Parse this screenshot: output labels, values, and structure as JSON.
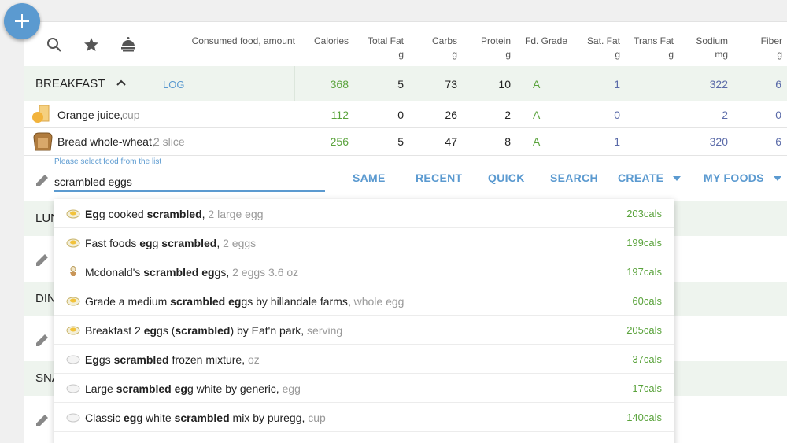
{
  "columns": [
    {
      "label": "Consumed food, amount",
      "unit": ""
    },
    {
      "label": "Calories",
      "unit": ""
    },
    {
      "label": "Total Fat",
      "unit": "g"
    },
    {
      "label": "Carbs",
      "unit": "g"
    },
    {
      "label": "Protein",
      "unit": "g"
    },
    {
      "label": "Fd. Grade",
      "unit": ""
    },
    {
      "label": "Sat. Fat",
      "unit": "g"
    },
    {
      "label": "Trans Fat",
      "unit": "g"
    },
    {
      "label": "Sodium",
      "unit": "mg"
    },
    {
      "label": "Fiber",
      "unit": "g"
    }
  ],
  "breakfast": {
    "title": "BREAKFAST",
    "log_label": "LOG",
    "totals": {
      "calories": "368",
      "fat": "5",
      "carbs": "73",
      "protein": "10",
      "grade": "A",
      "sat_fat": "1",
      "sodium": "322",
      "fiber": "6"
    },
    "items": [
      {
        "name": "Orange juice,",
        "amount": "cup",
        "calories": "112",
        "fat": "0",
        "carbs": "26",
        "protein": "2",
        "grade": "A",
        "sat_fat": "0",
        "sodium": "2",
        "fiber": "0"
      },
      {
        "name": "Bread whole-wheat,",
        "amount": "2 slice",
        "calories": "256",
        "fat": "5",
        "carbs": "47",
        "protein": "8",
        "grade": "A",
        "sat_fat": "1",
        "sodium": "320",
        "fiber": "6"
      }
    ]
  },
  "search": {
    "hint": "Please select food from the list",
    "value": "scrambled eggs"
  },
  "tabs": [
    "SAME",
    "RECENT",
    "QUICK",
    "SEARCH",
    "CREATE",
    "MY FOODS"
  ],
  "sections": [
    "LUN",
    "DIN",
    "SNA"
  ],
  "suggestions": [
    {
      "icon": "egg-icon",
      "parts": [
        [
          "Eg",
          true
        ],
        [
          "g cooked ",
          false
        ],
        [
          "scrambled",
          true
        ],
        [
          ",",
          false
        ]
      ],
      "amount": "2 large egg",
      "cals": "203cals"
    },
    {
      "icon": "egg-icon",
      "parts": [
        [
          "Fast foods ",
          false
        ],
        [
          "eg",
          true
        ],
        [
          "g ",
          false
        ],
        [
          "scrambled",
          true
        ],
        [
          ",",
          false
        ]
      ],
      "amount": "2 eggs",
      "cals": "199cals"
    },
    {
      "icon": "egg-cup-icon",
      "parts": [
        [
          "Mcdonald's ",
          false
        ],
        [
          "scrambled eg",
          true
        ],
        [
          "gs,",
          false
        ]
      ],
      "amount": "2 eggs 3.6 oz",
      "cals": "197cals"
    },
    {
      "icon": "egg-icon",
      "parts": [
        [
          "Grade a medium ",
          false
        ],
        [
          "scrambled eg",
          true
        ],
        [
          "gs by hillandale farms,",
          false
        ]
      ],
      "amount": "whole egg",
      "cals": "60cals"
    },
    {
      "icon": "egg-icon",
      "parts": [
        [
          "Breakfast 2 ",
          false
        ],
        [
          "eg",
          true
        ],
        [
          "gs (",
          false
        ],
        [
          "scrambled",
          true
        ],
        [
          ") by Eat'n park,",
          false
        ]
      ],
      "amount": "serving",
      "cals": "205cals"
    },
    {
      "icon": "egg-white-icon",
      "parts": [
        [
          "Eg",
          true
        ],
        [
          "gs ",
          false
        ],
        [
          "scrambled",
          true
        ],
        [
          " frozen mixture,",
          false
        ]
      ],
      "amount": "oz",
      "cals": "37cals"
    },
    {
      "icon": "egg-white-icon",
      "parts": [
        [
          "Large ",
          false
        ],
        [
          "scrambled eg",
          true
        ],
        [
          "g white by generic,",
          false
        ]
      ],
      "amount": "egg",
      "cals": "17cals"
    },
    {
      "icon": "egg-white-icon",
      "parts": [
        [
          "Classic ",
          false
        ],
        [
          "eg",
          true
        ],
        [
          "g white ",
          false
        ],
        [
          "scrambled",
          true
        ],
        [
          " mix by puregg,",
          false
        ]
      ],
      "amount": "cup",
      "cals": "140cals"
    }
  ],
  "colors": {
    "accent": "#5b9ad0",
    "calories": "#5aa33c",
    "satfat_sodium": "#5a6aa8",
    "section_band": "#eef4ee"
  }
}
